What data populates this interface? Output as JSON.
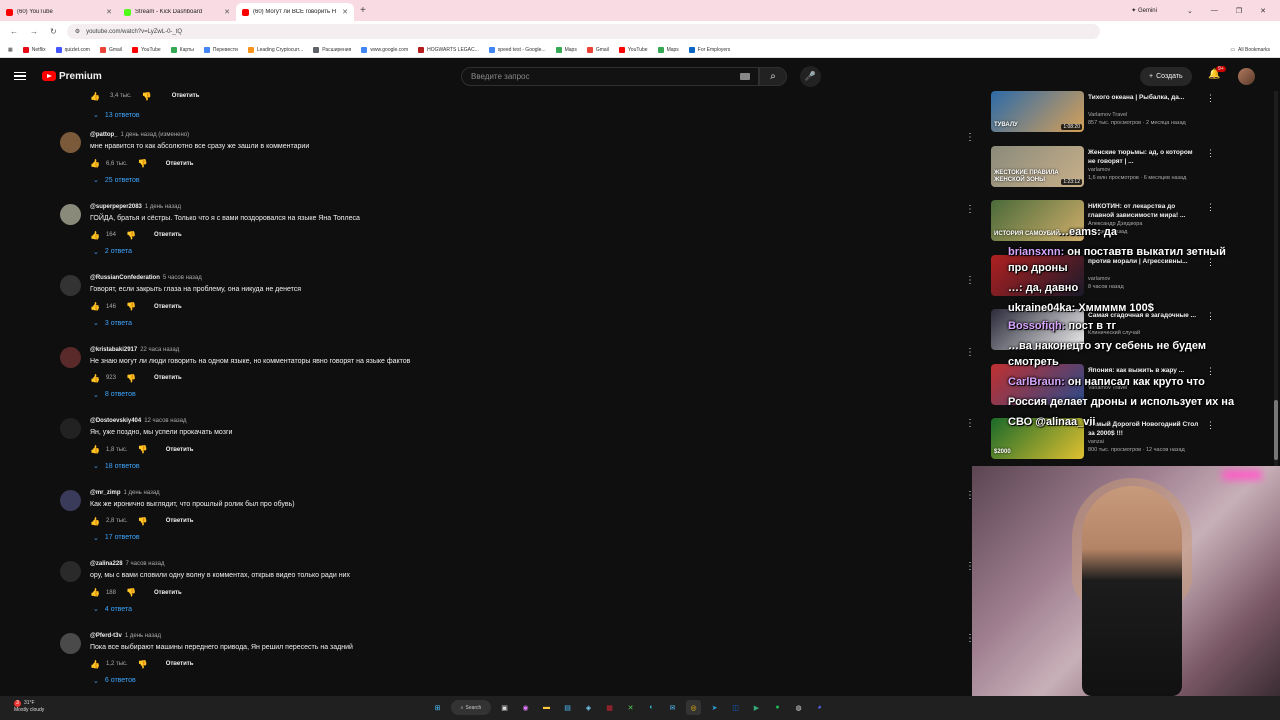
{
  "browser": {
    "tabs": [
      {
        "title": "(60) YouTube",
        "color": "#ff0000"
      },
      {
        "title": "Stream - Kick Dashboard",
        "color": "#53fc18"
      },
      {
        "title": "(60) Могут ли ВСЕ говорить Н",
        "color": "#ff0000",
        "active": true
      }
    ],
    "gemini": "Gemini",
    "url": "youtube.com/watch?v=LyZwL-0-_tQ",
    "bookmarks": [
      {
        "label": "Netflix",
        "color": "#e50914"
      },
      {
        "label": "quizlet.com",
        "color": "#4255ff"
      },
      {
        "label": "Gmail",
        "color": "#ea4335"
      },
      {
        "label": "YouTube",
        "color": "#ff0000"
      },
      {
        "label": "Карты",
        "color": "#34a853"
      },
      {
        "label": "Перевести",
        "color": "#4285f4"
      },
      {
        "label": "Leading Cryptocurr...",
        "color": "#f7931a"
      },
      {
        "label": "Расширения",
        "color": "#5f6368"
      },
      {
        "label": "www.google.com",
        "color": "#4285f4"
      },
      {
        "label": "HOGWARTS LEGAC...",
        "color": "#b71c1c"
      },
      {
        "label": "speed test - Google...",
        "color": "#4285f4"
      },
      {
        "label": "Maps",
        "color": "#34a853"
      },
      {
        "label": "Gmail",
        "color": "#ea4335"
      },
      {
        "label": "YouTube",
        "color": "#ff0000"
      },
      {
        "label": "Maps",
        "color": "#34a853"
      },
      {
        "label": "For Employers",
        "color": "#0a66c2"
      }
    ],
    "all_bookmarks": "All Bookmarks"
  },
  "yt": {
    "logo": "Premium",
    "search_placeholder": "Введите запрос",
    "create": "Создать",
    "notif_count": "9+"
  },
  "comments": {
    "top_likes": "3,4 тыс.",
    "top_answer": "Ответить",
    "top_replies": "13 ответов",
    "items": [
      {
        "user": "@pattop_",
        "time": "1 день назад (изменено)",
        "text": "мне нравится то как абсолютно все сразу же зашли в комментарии",
        "likes": "6,6 тыс.",
        "answer": "Ответить",
        "replies": "25 ответов"
      },
      {
        "user": "@superpeper2083",
        "time": "1 день назад",
        "text": "ГОЙДА, братья и сёстры. Только что я с вами поздоровался на языке Яна Топлеса",
        "likes": "164",
        "answer": "Ответить",
        "replies": "2 ответа"
      },
      {
        "user": "@RussianConfederation",
        "time": "5 часов назад",
        "text": "Говорят, если закрыть глаза на проблему, она никуда не денется",
        "likes": "146",
        "answer": "Ответить",
        "replies": "3 ответа"
      },
      {
        "user": "@kristabaki2917",
        "time": "22 часа назад",
        "text": "Не знаю могут ли люди говорить на одном языке, но комментаторы явно говорят на языке фактов",
        "likes": "923",
        "answer": "Ответить",
        "replies": "8 ответов"
      },
      {
        "user": "@Dostoevskiy404",
        "time": "12 часов назад",
        "text": "Ян, уже поздно, мы успели прокачать мозги",
        "likes": "1,8 тыс.",
        "answer": "Ответить",
        "replies": "18 ответов"
      },
      {
        "user": "@mr_zimp",
        "time": "1 день назад",
        "text": "Как же иронично выглядит, что прошлый ролик был про обувь)",
        "likes": "2,8 тыс.",
        "answer": "Ответить",
        "replies": "17 ответов"
      },
      {
        "user": "@zalina228",
        "time": "7 часов назад",
        "text": "ору, мы с вами словили одну волну в комментах, открыв видео только ради них",
        "likes": "188",
        "answer": "Ответить",
        "replies": "4 ответа"
      },
      {
        "user": "@Pferd-t3v",
        "time": "1 день назад",
        "text": "Пока все выбирают машины переднего привода, Ян решил пересесть на задний",
        "likes": "1,2 тыс.",
        "answer": "Ответить",
        "replies": "6 ответов"
      }
    ]
  },
  "related": [
    {
      "title": "Тихого океана | Рыбалка, да...",
      "channel": "Varlamov Travel",
      "meta": "857 тыс. просмотров · 2 месяца назад",
      "duration": "1:08:20",
      "thumb_text": "ТУВАЛУ",
      "color1": "#2c6aa8",
      "color2": "#d6a058"
    },
    {
      "title": "Женские тюрьмы: ад, о котором не говорят | ...",
      "channel": "varlamov",
      "meta": "1,6 млн просмотров · 6 месяцев назад",
      "duration": "1:23:12",
      "thumb_text": "ЖЕСТОКИЕ ПРАВИЛА ЖЕНСКОЙ ЗОНЫ",
      "color1": "#8a8a7a",
      "color2": "#c9b08a"
    },
    {
      "title": "НИКОТИН: от лекарства до главной зависимости мира! ...",
      "channel": "Александр Дзядзюра",
      "meta": "2 недели назад",
      "duration": "",
      "thumb_text": "ИСТОРИЯ САМОУБИЙ...",
      "color1": "#4a6a3a",
      "color2": "#cfae6a"
    },
    {
      "title": "против морали | Агрессивны...",
      "channel": "varlamov",
      "meta": "8 часов назад",
      "duration": "",
      "thumb_text": "",
      "color1": "#b02020",
      "color2": "#1a1a2a"
    },
    {
      "title": "Самая сгадочная в загадочные ...",
      "channel": "Клинический случай",
      "meta": "",
      "duration": "",
      "thumb_text": "",
      "color1": "#2a2a3a",
      "color2": "#f0f0f0"
    },
    {
      "title": "Япония: как выжить в жару ...",
      "channel": "Varlamov Travel",
      "meta": "",
      "duration": "",
      "thumb_text": "",
      "color1": "#c03030",
      "color2": "#2a4a8a"
    },
    {
      "title": "Самый Дорогой Новогодний Стол за 2000$ !!!",
      "channel": "vanzai",
      "meta": "800 тыс. просмотров · 12 часов назад",
      "duration": "",
      "thumb_text": "$2000",
      "color1": "#1a6a2a",
      "color2": "#e0c030"
    }
  ],
  "chat": [
    {
      "nick": "",
      "text": "…eams: да"
    },
    {
      "nick": "briansxnn:",
      "text": "он поставтв выкатил зетный"
    },
    {
      "nick": "",
      "text": "про дроны"
    },
    {
      "nick": "",
      "text": "…: да, давно"
    },
    {
      "nick": "",
      "text": "ukraine04ka: Хммммм 100$"
    },
    {
      "nick": "Bossofiqh:",
      "text": "пост в тг"
    },
    {
      "nick": "",
      "text": "…вa наконецто эту себень не будем"
    },
    {
      "nick": "",
      "text": "смотреть"
    },
    {
      "nick": "CarlBraun:",
      "text": "он написал как круто что"
    },
    {
      "nick": "",
      "text": "Россия делает дроны и использует их на"
    },
    {
      "nick": "",
      "text": "СВО @alinaa_vii"
    }
  ],
  "taskbar": {
    "weather_temp": "31°F",
    "weather_desc": "Mostly cloudy",
    "weather_badge": "3",
    "search": "Search"
  }
}
